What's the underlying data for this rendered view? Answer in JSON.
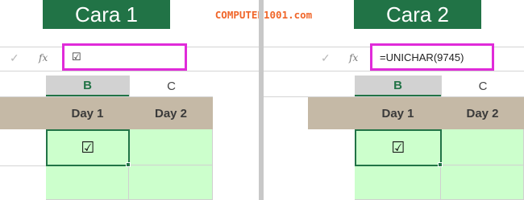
{
  "brand": {
    "text": "COMPUTER1001.com"
  },
  "left": {
    "title": "Cara 1",
    "formula": "☑",
    "columns": {
      "b": "B",
      "c": "C"
    },
    "headers": {
      "day1": "Day 1",
      "day2": "Day 2"
    },
    "cell_value": "☑",
    "cancel_glyph": "✓",
    "fx_label": "fx"
  },
  "right": {
    "title": "Cara 2",
    "formula": "=UNICHAR(9745)",
    "columns": {
      "b": "B",
      "c": "C"
    },
    "headers": {
      "day1": "Day 1",
      "day2": "Day 2"
    },
    "cell_value": "☑",
    "cancel_glyph": "✓",
    "fx_label": "fx"
  },
  "colors": {
    "excel_green": "#217346",
    "highlight_box": "#e02bd9",
    "header_band": "#c5b9a6",
    "cell_fill": "#ccffcc",
    "brand_text": "#f0662a"
  }
}
